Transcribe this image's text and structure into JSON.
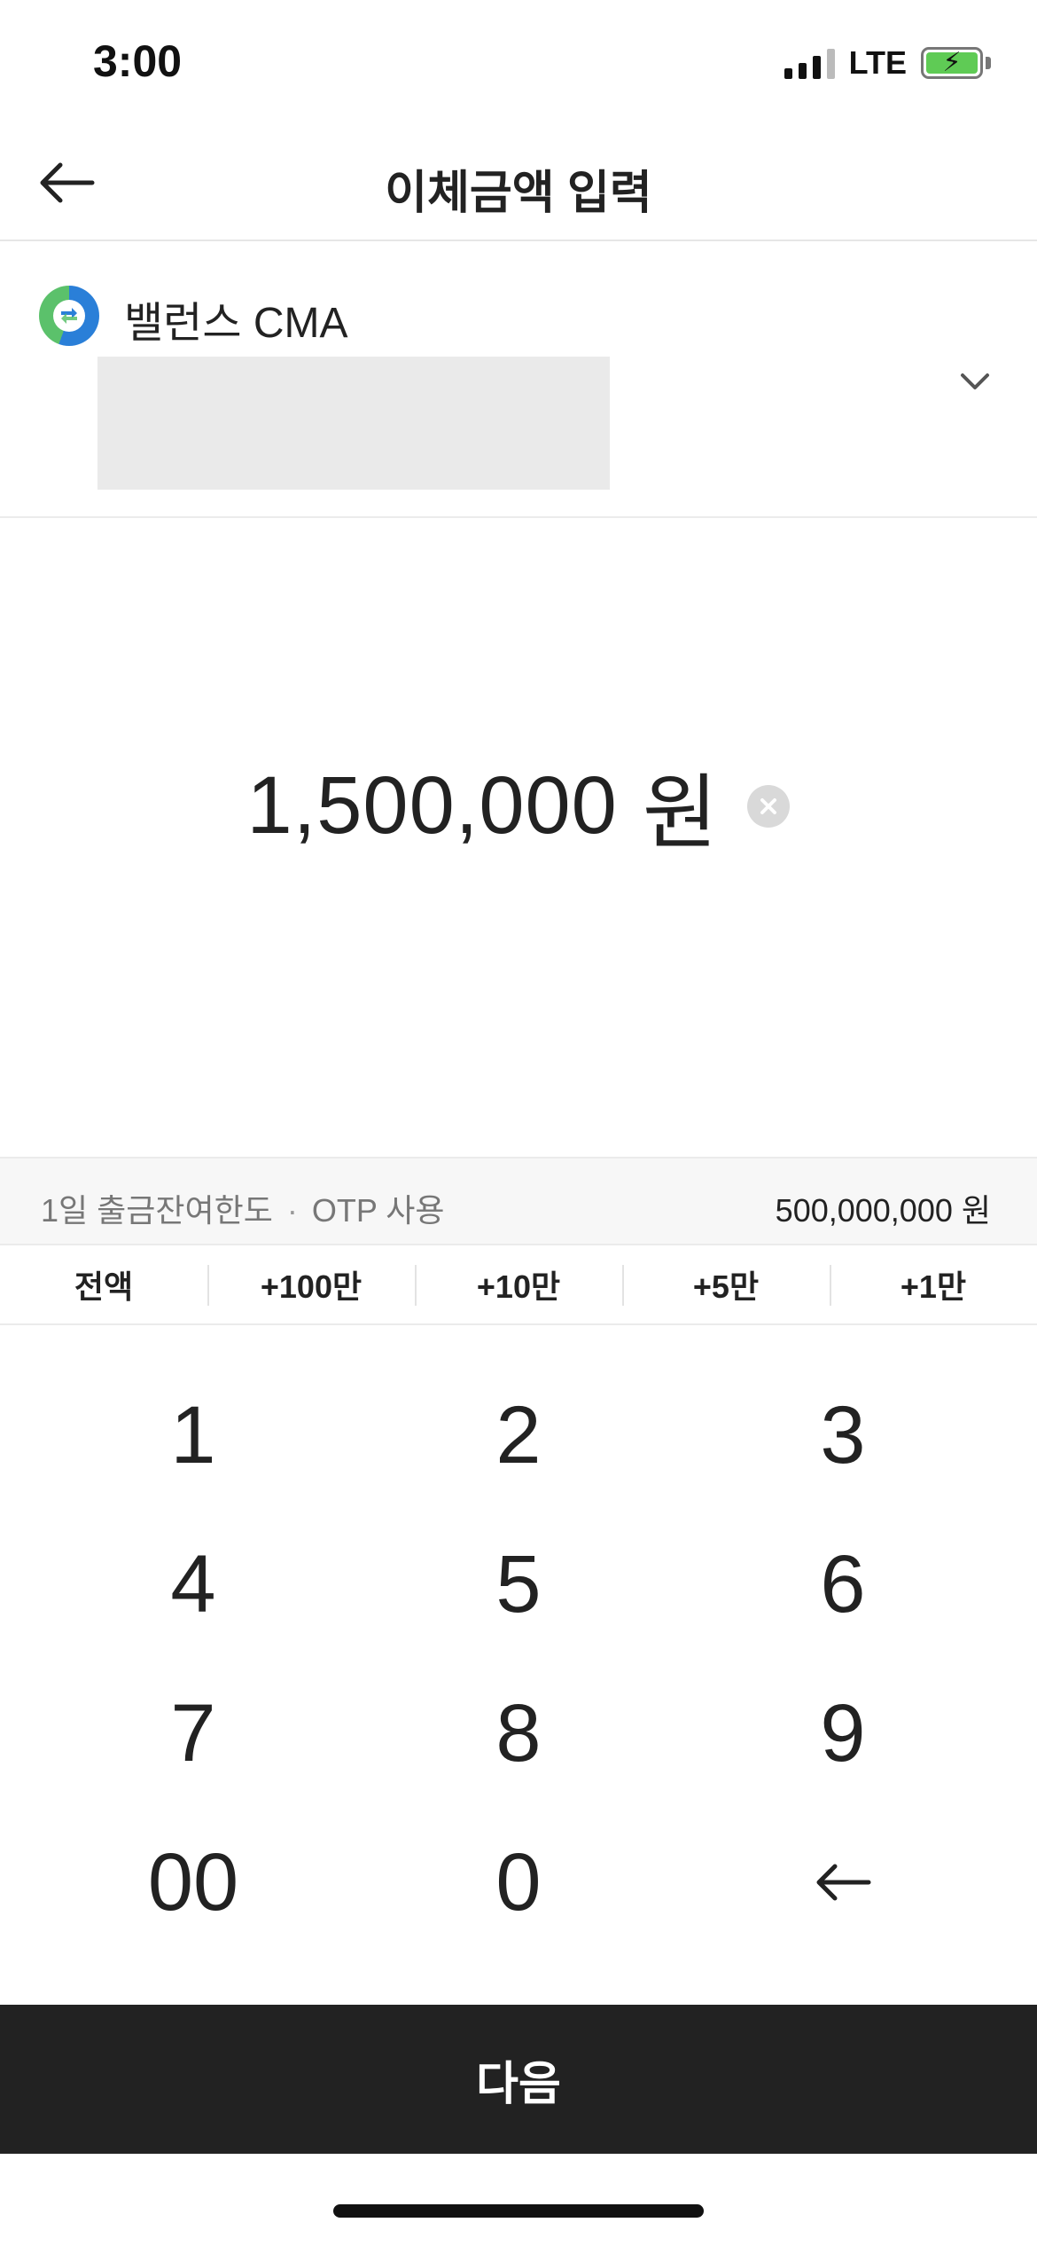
{
  "status_bar": {
    "time": "3:00",
    "network": "LTE",
    "signal_icon": "signal-bars-icon",
    "battery_icon": "battery-charging-icon",
    "battery_color": "#5fcb55"
  },
  "header": {
    "title": "이체금액 입력",
    "back_icon": "back-arrow-icon"
  },
  "account": {
    "name": "밸런스 CMA",
    "logo_icon": "bank-logo-icon",
    "dropdown_icon": "chevron-down-icon"
  },
  "amount": {
    "value": "1,500,000",
    "unit": "원",
    "clear_icon": "clear-icon"
  },
  "limit": {
    "label": "1일 출금잔여한도",
    "otp": "OTP 사용",
    "value": "500,000,000 원"
  },
  "quick_add": [
    "전액",
    "+100만",
    "+10만",
    "+5만",
    "+1만"
  ],
  "keypad": {
    "keys": [
      "1",
      "2",
      "3",
      "4",
      "5",
      "6",
      "7",
      "8",
      "9",
      "00",
      "0"
    ],
    "backspace_icon": "backspace-arrow-icon"
  },
  "next_button": {
    "label": "다음",
    "background": "#222222"
  }
}
